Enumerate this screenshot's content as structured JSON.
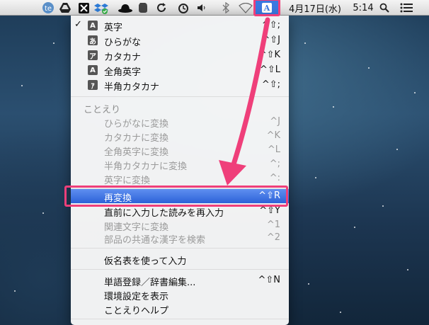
{
  "menubar": {
    "items": [
      {
        "name": "te-icon"
      },
      {
        "name": "google-drive-icon"
      },
      {
        "name": "x-app-icon"
      },
      {
        "name": "dropbox-icon"
      },
      {
        "name": "hat-icon"
      },
      {
        "name": "evernote-icon"
      },
      {
        "name": "sync-icon"
      },
      {
        "name": "time-machine-icon"
      },
      {
        "name": "volume-icon"
      },
      {
        "name": "bluetooth-icon"
      },
      {
        "name": "wifi-icon"
      }
    ],
    "ime_label": "A",
    "date": "4月17日(水)",
    "time": "5:14"
  },
  "menu": {
    "modes": [
      {
        "check": "✓",
        "badge": "A",
        "label": "英字",
        "shortcut": "^⇧;"
      },
      {
        "check": "",
        "badge": "あ",
        "label": "ひらがな",
        "shortcut": "^⇧J"
      },
      {
        "check": "",
        "badge": "ア",
        "label": "カタカナ",
        "shortcut": "^⇧K"
      },
      {
        "check": "",
        "badge": "A",
        "label": "全角英字",
        "shortcut": "^⇧L"
      },
      {
        "check": "",
        "badge": "ｱ",
        "label": "半角カタカナ",
        "shortcut": "^⇧;"
      }
    ],
    "kotoeri_header": "ことえり",
    "convert_items": [
      {
        "label": "ひらがなに変換",
        "shortcut": "^J"
      },
      {
        "label": "カタカナに変換",
        "shortcut": "^K"
      },
      {
        "label": "全角英字に変換",
        "shortcut": "^L"
      },
      {
        "label": "半角カタカナに変換",
        "shortcut": "^;"
      },
      {
        "label": "英字に変換",
        "shortcut": "^:"
      }
    ],
    "reconvert": {
      "label": "再変換",
      "shortcut": "^⇧R"
    },
    "reinput": {
      "label": "直前に入力した読みを再入力",
      "shortcut": "^⇧Y"
    },
    "related": {
      "label": "関連文字に変換",
      "shortcut": "^1"
    },
    "kanji_search": {
      "label": "部品の共通な漢字を検索",
      "shortcut": "^2"
    },
    "kana_table": {
      "label": "仮名表を使って入力"
    },
    "word_register": {
      "label": "単語登録／辞書編集...",
      "shortcut": "^⇧N"
    },
    "preferences": {
      "label": "環境設定を表示"
    },
    "help": {
      "label": "ことえりヘルプ"
    }
  },
  "colors": {
    "highlight": "#ef3f7a",
    "selection": "#2c62d8"
  }
}
